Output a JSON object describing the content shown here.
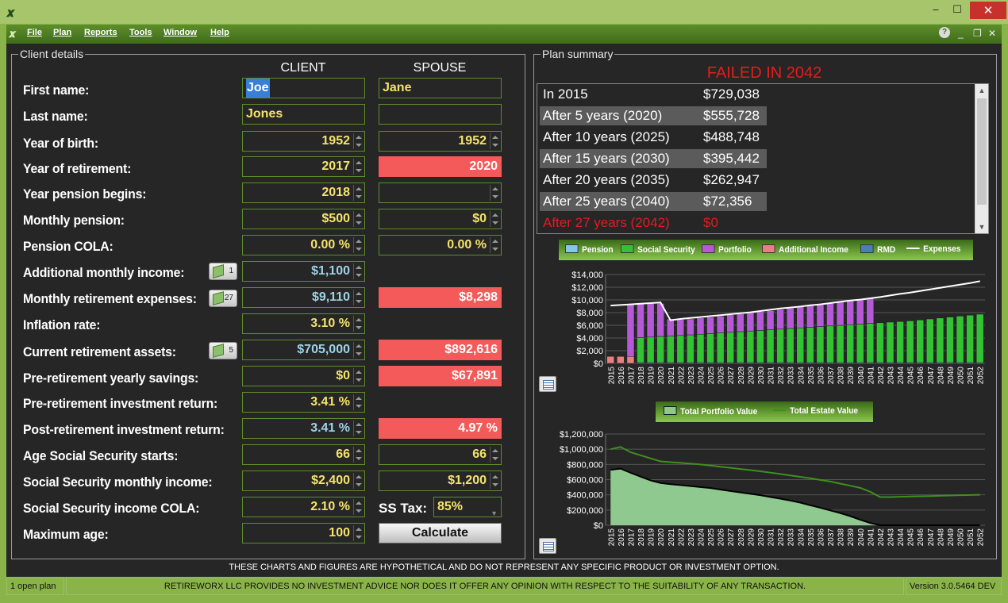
{
  "app": {
    "menu": [
      "File",
      "Plan",
      "Reports",
      "Tools",
      "Window",
      "Help"
    ],
    "window_min": "‒",
    "window_max": "☐",
    "window_close": "✕",
    "help_glyph": "?",
    "child_min": "_",
    "child_restore": "❐",
    "child_close": "✕"
  },
  "client_details": {
    "title": "Client details",
    "col_client": "CLIENT",
    "col_spouse": "SPOUSE",
    "labels": {
      "first_name": "First name:",
      "last_name": "Last name:",
      "year_of_birth": "Year of birth:",
      "year_of_retirement": "Year of retirement:",
      "year_pension_begins": "Year pension begins:",
      "monthly_pension": "Monthly pension:",
      "pension_cola": "Pension COLA:",
      "additional_monthly_income": "Additional monthly income:",
      "monthly_retirement_expenses": "Monthly retirement expenses:",
      "inflation_rate": "Inflation rate:",
      "current_retirement_assets": "Current retirement assets:",
      "pre_retirement_yearly_savings": "Pre-retirement yearly savings:",
      "pre_retirement_investment_return": "Pre-retirement investment return:",
      "post_retirement_investment_return": "Post-retirement investment return:",
      "age_social_security_starts": "Age Social Security starts:",
      "social_security_monthly_income": "Social Security monthly income:",
      "social_security_income_cola": "Social Security income COLA:",
      "maximum_age": "Maximum age:"
    },
    "client": {
      "first_name": "Joe",
      "last_name": "Jones",
      "year_of_birth": "1952",
      "year_of_retirement": "2017",
      "year_pension_begins": "2018",
      "monthly_pension": "$500",
      "pension_cola": "0.00 %",
      "additional_monthly_income": "$1,100",
      "monthly_retirement_expenses": "$9,110",
      "inflation_rate": "3.10 %",
      "current_retirement_assets": "$705,000",
      "pre_retirement_yearly_savings": "$0",
      "pre_retirement_investment_return": "3.41 %",
      "post_retirement_investment_return": "3.41 %",
      "age_social_security_starts": "66",
      "social_security_monthly_income": "$2,400",
      "social_security_income_cola": "2.10 %",
      "maximum_age": "100"
    },
    "spouse": {
      "first_name": "Jane",
      "last_name": "",
      "year_of_birth": "1952",
      "year_of_retirement": "2020",
      "year_pension_begins": "",
      "monthly_pension": "$0",
      "pension_cola": "0.00 %",
      "monthly_retirement_expenses": "$8,298",
      "current_retirement_assets": "$892,616",
      "pre_retirement_yearly_savings": "$67,891",
      "post_retirement_investment_return": "4.97 %",
      "age_social_security_starts": "66",
      "social_security_monthly_income": "$1,200"
    },
    "badges": {
      "additional_income_count": "1",
      "expenses_count": "27",
      "assets_count": "5"
    },
    "ss_tax_label": "SS Tax:",
    "ss_tax_value": "85%",
    "calculate_label": "Calculate"
  },
  "plan_summary": {
    "title": "Plan summary",
    "status": "FAILED IN 2042",
    "rows": [
      {
        "label": "In 2015",
        "amount": "$729,038"
      },
      {
        "label": "After 5 years (2020)",
        "amount": "$555,728"
      },
      {
        "label": "After 10 years (2025)",
        "amount": "$488,748"
      },
      {
        "label": "After 15 years (2030)",
        "amount": "$395,442"
      },
      {
        "label": "After 20 years (2035)",
        "amount": "$262,947"
      },
      {
        "label": "After 25 years (2040)",
        "amount": "$72,356"
      },
      {
        "label": "After 27 years (2042)",
        "amount": "$0"
      }
    ]
  },
  "chart_data": [
    {
      "type": "bar",
      "stacked": true,
      "legend": [
        "Pension",
        "Social Security",
        "Portfolio",
        "Additional Income",
        "RMD",
        "Expenses"
      ],
      "colors": {
        "Pension": "#86c6e6",
        "Social Security": "#33c233",
        "Portfolio": "#b45ad6",
        "Additional Income": "#e88080",
        "RMD": "#4a7fb3",
        "Expenses": "#ffffff"
      },
      "categories": [
        "2015",
        "2016",
        "2017",
        "2018",
        "2019",
        "2020",
        "2021",
        "2022",
        "2023",
        "2024",
        "2025",
        "2026",
        "2027",
        "2028",
        "2029",
        "2030",
        "2031",
        "2032",
        "2033",
        "2034",
        "2035",
        "2036",
        "2037",
        "2038",
        "2039",
        "2040",
        "2041",
        "2042",
        "2043",
        "2044",
        "2045",
        "2046",
        "2047",
        "2048",
        "2049",
        "2050",
        "2051",
        "2052"
      ],
      "ylim": [
        0,
        14000
      ],
      "yticks": [
        "$0",
        "$2,000",
        "$4,000",
        "$6,000",
        "$8,000",
        "$10,000",
        "$12,000",
        "$14,000"
      ],
      "series": [
        {
          "name": "Pension",
          "values": [
            0,
            0,
            0,
            150,
            150,
            150,
            150,
            150,
            150,
            150,
            150,
            150,
            150,
            150,
            150,
            150,
            150,
            150,
            150,
            150,
            150,
            150,
            150,
            150,
            150,
            150,
            150,
            150,
            150,
            150,
            150,
            150,
            150,
            150,
            150,
            150,
            150,
            150
          ]
        },
        {
          "name": "Social Security",
          "values": [
            0,
            0,
            0,
            3900,
            4000,
            4100,
            4150,
            4250,
            4350,
            4450,
            4550,
            4650,
            4750,
            4850,
            4950,
            5050,
            5150,
            5250,
            5350,
            5450,
            5550,
            5650,
            5750,
            5850,
            5950,
            6050,
            6150,
            6250,
            6350,
            6450,
            6550,
            6700,
            6850,
            7000,
            7150,
            7300,
            7450,
            7600
          ]
        },
        {
          "name": "Portfolio",
          "values": [
            0,
            0,
            8200,
            5300,
            5300,
            5200,
            2700,
            2500,
            2500,
            2550,
            2600,
            2650,
            2750,
            2800,
            2900,
            2950,
            3000,
            3100,
            3200,
            3300,
            3400,
            3450,
            3550,
            3650,
            3750,
            3850,
            3950,
            0,
            0,
            0,
            0,
            0,
            0,
            0,
            0,
            0,
            0,
            0
          ]
        },
        {
          "name": "Additional Income",
          "values": [
            1100,
            1100,
            1100,
            0,
            0,
            0,
            0,
            0,
            0,
            0,
            0,
            0,
            0,
            0,
            0,
            0,
            0,
            0,
            0,
            0,
            0,
            0,
            0,
            0,
            0,
            0,
            0,
            0,
            0,
            0,
            0,
            0,
            0,
            0,
            0,
            0,
            0,
            0
          ]
        },
        {
          "name": "RMD",
          "values": [
            0,
            0,
            0,
            0,
            0,
            0,
            0,
            0,
            0,
            0,
            0,
            0,
            0,
            0,
            0,
            0,
            0,
            0,
            0,
            0,
            0,
            0,
            0,
            0,
            0,
            0,
            0,
            0,
            0,
            0,
            0,
            0,
            0,
            0,
            0,
            0,
            0,
            0
          ]
        },
        {
          "name": "Expenses",
          "values": [
            9110,
            9200,
            9300,
            9400,
            9500,
            9600,
            6800,
            7000,
            7150,
            7300,
            7450,
            7600,
            7750,
            7900,
            8050,
            8250,
            8450,
            8650,
            8800,
            8950,
            9150,
            9300,
            9500,
            9700,
            9900,
            10050,
            10250,
            10450,
            10700,
            10950,
            11150,
            11400,
            11650,
            11900,
            12150,
            12400,
            12650,
            12950
          ]
        }
      ]
    },
    {
      "type": "area",
      "legend": [
        "Total Portfolio Value",
        "Total Estate Value"
      ],
      "colors": {
        "Total Portfolio Value": "#8fc98f",
        "Total Estate Value": "#3f8f1f"
      },
      "categories": [
        "2015",
        "2016",
        "2017",
        "2018",
        "2019",
        "2020",
        "2021",
        "2022",
        "2023",
        "2024",
        "2025",
        "2026",
        "2027",
        "2028",
        "2029",
        "2030",
        "2031",
        "2032",
        "2033",
        "2034",
        "2035",
        "2036",
        "2037",
        "2038",
        "2039",
        "2040",
        "2041",
        "2042",
        "2043",
        "2044",
        "2045",
        "2046",
        "2047",
        "2048",
        "2049",
        "2050",
        "2051",
        "2052"
      ],
      "ylim": [
        0,
        1200000
      ],
      "yticks": [
        "$0",
        "$200,000",
        "$400,000",
        "$600,000",
        "$800,000",
        "$1,000,000",
        "$1,200,000"
      ],
      "series": [
        {
          "name": "Total Portfolio Value",
          "values": [
            729038,
            745000,
            690000,
            640000,
            590000,
            555728,
            540000,
            528000,
            515000,
            502000,
            488748,
            470000,
            450000,
            432000,
            414000,
            395442,
            372000,
            350000,
            325000,
            297000,
            262947,
            230000,
            195000,
            160000,
            120000,
            72356,
            30000,
            0,
            0,
            0,
            0,
            0,
            0,
            0,
            0,
            0,
            0,
            0
          ]
        },
        {
          "name": "Total Estate Value",
          "values": [
            1000000,
            1030000,
            960000,
            920000,
            880000,
            840000,
            830000,
            820000,
            810000,
            800000,
            785000,
            770000,
            755000,
            740000,
            725000,
            710000,
            692000,
            674000,
            655000,
            636000,
            618000,
            596000,
            575000,
            548000,
            520000,
            492000,
            440000,
            370000,
            370000,
            375000,
            378000,
            381000,
            384000,
            388000,
            391000,
            395000,
            398000,
            401000
          ]
        }
      ]
    }
  ],
  "footer": {
    "disclaimer": "THESE CHARTS AND FIGURES ARE HYPOTHETICAL AND DO NOT REPRESENT ANY SPECIFIC PRODUCT OR INVESTMENT OPTION.",
    "open_plans": "1 open plan",
    "advice": "RETIREWORX LLC PROVIDES NO INVESTMENT ADVICE NOR DOES IT OFFER ANY OPINION WITH RESPECT TO THE SUITABILITY OF ANY TRANSACTION.",
    "version": "Version 3.0.5464 DEV"
  }
}
